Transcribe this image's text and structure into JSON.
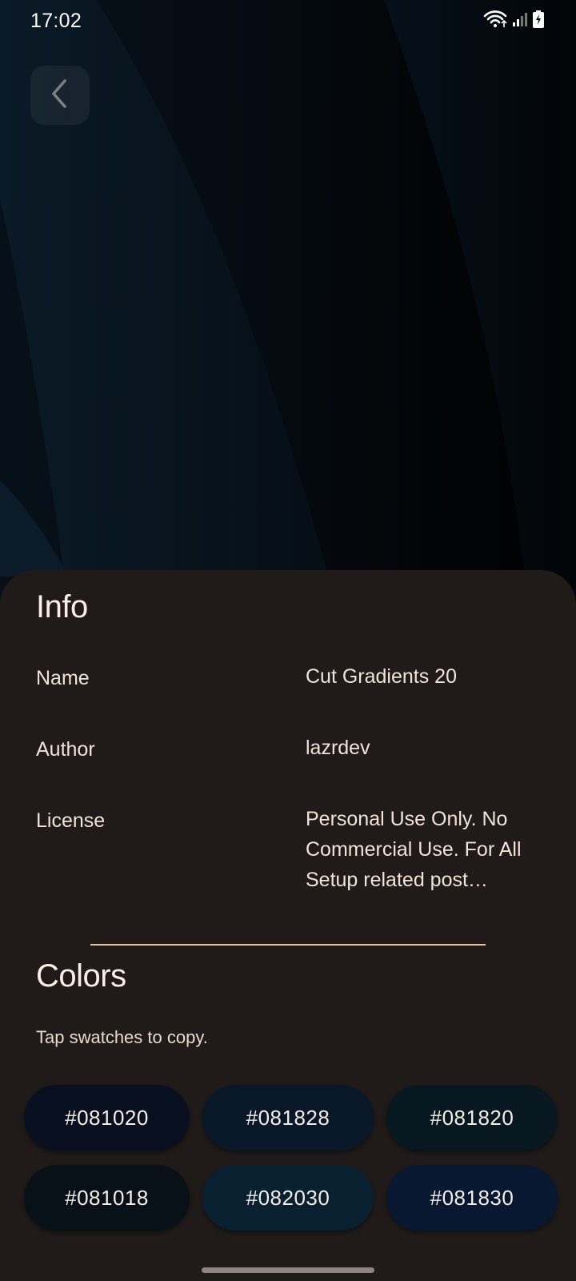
{
  "status_bar": {
    "time": "17:02"
  },
  "info": {
    "title": "Info",
    "rows": [
      {
        "label": "Name",
        "value": "Cut Gradients 20"
      },
      {
        "label": "Author",
        "value": "lazrdev"
      },
      {
        "label": "License",
        "value": "Personal Use Only. No Commercial Use. For All Setup related post…"
      }
    ]
  },
  "colors": {
    "title": "Colors",
    "hint": "Tap swatches to copy.",
    "swatches": [
      {
        "label": "#081020",
        "color": "#081020"
      },
      {
        "label": "#081828",
        "color": "#081828"
      },
      {
        "label": "#081820",
        "color": "#081820"
      },
      {
        "label": "#081018",
        "color": "#081018"
      },
      {
        "label": "#082030",
        "color": "#082030"
      },
      {
        "label": "#081830",
        "color": "#081830"
      }
    ]
  }
}
